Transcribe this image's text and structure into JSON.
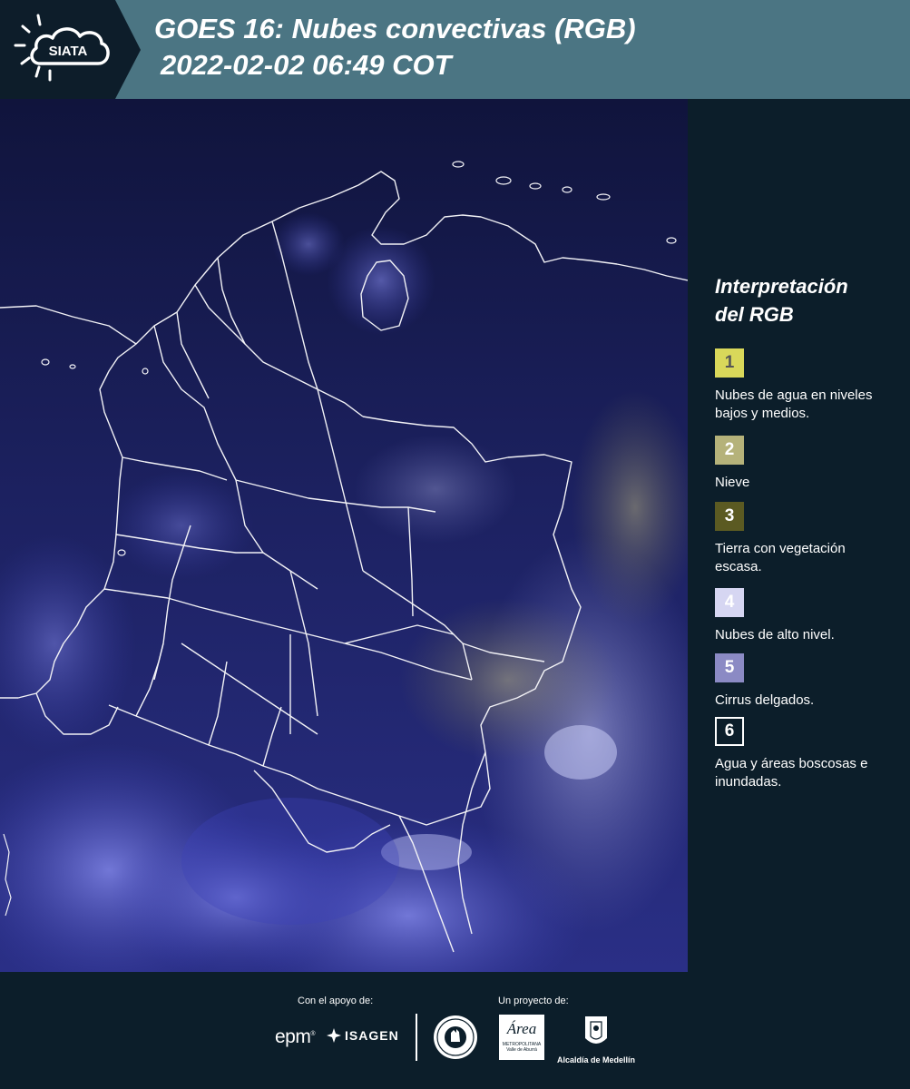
{
  "header": {
    "logo_text": "SIATA",
    "title_line1": "GOES 16: Nubes convectivas (RGB)",
    "title_line2": "2022-02-02 06:49 COT"
  },
  "legend": {
    "title_line1": "Interpretación",
    "title_line2": "del RGB",
    "items": [
      {
        "number": "1",
        "label": "Nubes de agua en niveles bajos y medios.",
        "color": "#d9d85a",
        "text_color": "#555555"
      },
      {
        "number": "2",
        "label": "Nieve",
        "color": "#b5b27a",
        "text_color": "#ffffff"
      },
      {
        "number": "3",
        "label": "Tierra con vegetación escasa.",
        "color": "#5b5a22",
        "text_color": "#ffffff"
      },
      {
        "number": "4",
        "label": "Nubes de alto nivel.",
        "color": "#d6d6f2",
        "text_color": "#ffffff"
      },
      {
        "number": "5",
        "label": "Cirrus delgados.",
        "color": "#8b8ac4",
        "text_color": "#ffffff"
      },
      {
        "number": "6",
        "label": "Agua y áreas boscosas e inundadas.",
        "color": "#0c1e2a",
        "text_color": "#ffffff"
      }
    ]
  },
  "footer": {
    "support_label": "Con el apoyo de:",
    "project_label": "Un proyecto de:",
    "sponsor1": "epm",
    "sponsor2": "ISAGEN",
    "partner1_line1": "Área",
    "partner1_line2": "METROPOLITANA",
    "partner1_line3": "Valle de Aburrá",
    "partner2": "Alcaldía de Medellín"
  }
}
